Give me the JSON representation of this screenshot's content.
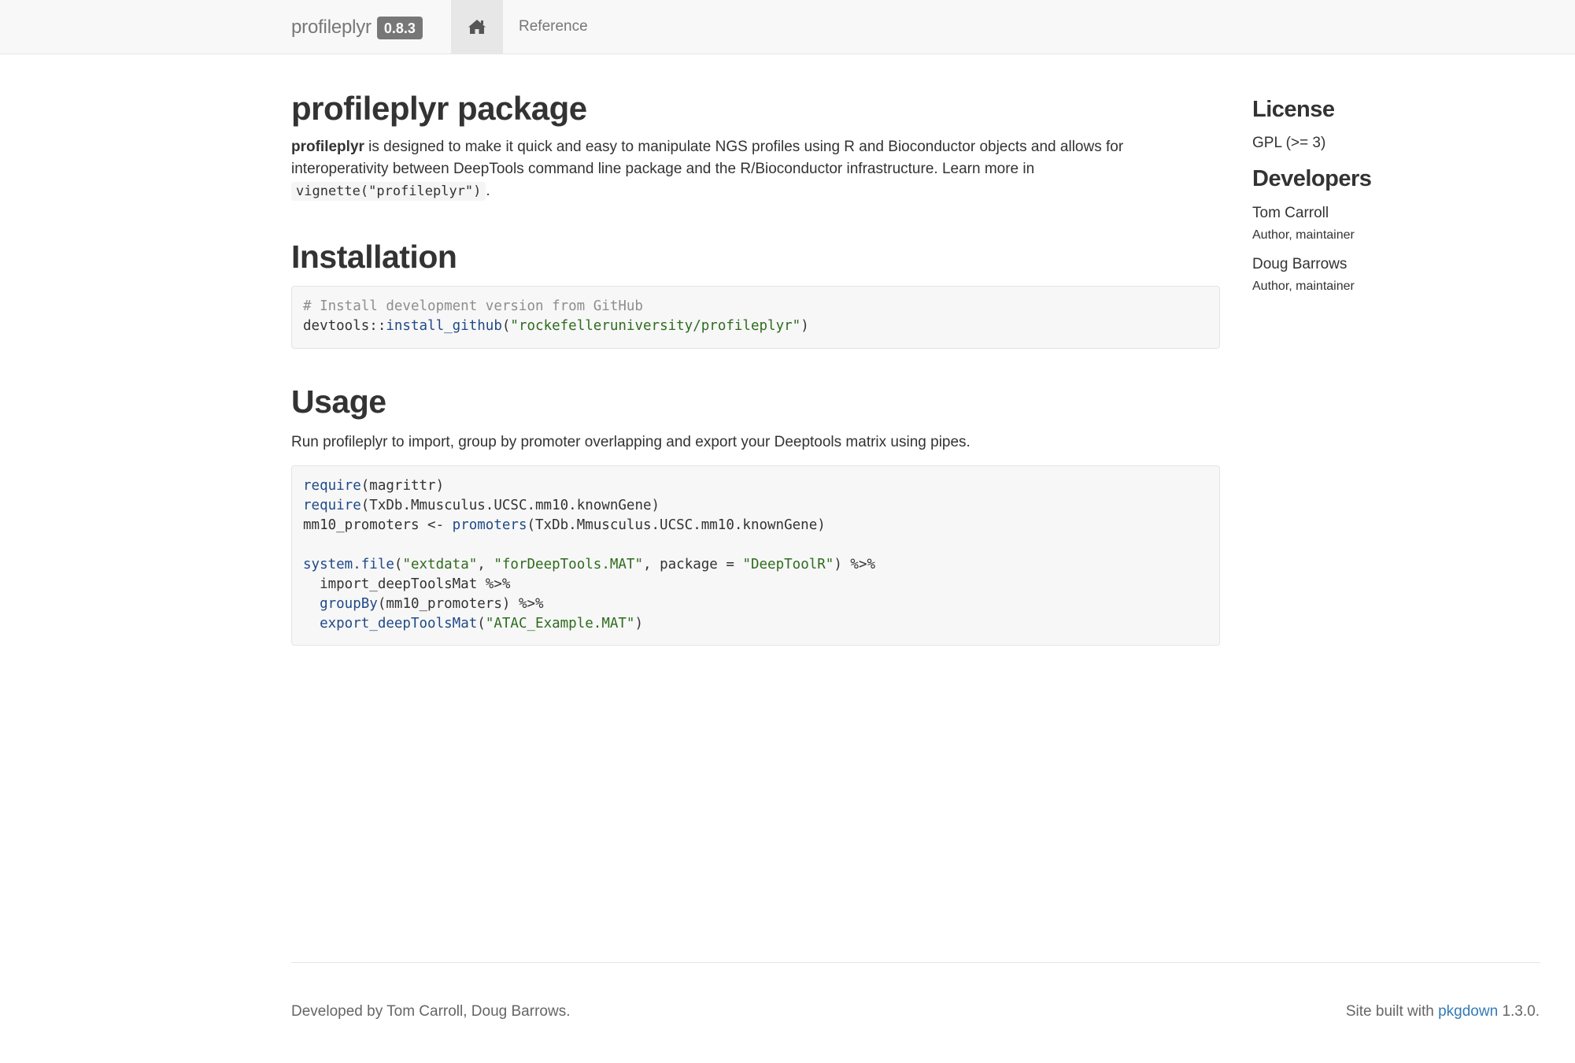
{
  "navbar": {
    "brand": "profileplyr",
    "version": "0.8.3",
    "home_icon": "home-icon",
    "reference_label": "Reference"
  },
  "main": {
    "title": "profileplyr package",
    "intro_strong": "profileplyr",
    "intro_text": " is designed to make it quick and easy to manipulate NGS profiles using R and Bioconductor objects and allows for interoperativity between DeepTools command line package and the R/Bioconductor infrastructure. Learn more in ",
    "intro_code": "vignette(\"profileplyr\")",
    "intro_end": ".",
    "installation_heading": "Installation",
    "install_code": {
      "comment": "# Install development version from GitHub",
      "line2_prefix": "devtools::",
      "line2_fn": "install_github",
      "line2_open": "(",
      "line2_str": "\"rockefelleruniversity/profileplyr\"",
      "line2_close": ")"
    },
    "usage_heading": "Usage",
    "usage_desc": "Run profileplyr to import, group by promoter overlapping and export your Deeptools matrix using pipes.",
    "usage_code": {
      "l1_fn": "require",
      "l1_rest": "(magrittr)",
      "l2_fn": "require",
      "l2_rest": "(TxDb.Mmusculus.UCSC.mm10.knownGene)",
      "l3_pre": "mm10_promoters <- ",
      "l3_fn": "promoters",
      "l3_rest": "(TxDb.Mmusculus.UCSC.mm10.knownGene)",
      "l5_fn": "system.file",
      "l5_open": "(",
      "l5_s1": "\"extdata\"",
      "l5_c1": ", ",
      "l5_s2": "\"forDeepTools.MAT\"",
      "l5_mid": ", package = ",
      "l5_s3": "\"DeepToolR\"",
      "l5_end": ") %>%",
      "l6": "  import_deepToolsMat %>%",
      "l7_indent": "  ",
      "l7_fn": "groupBy",
      "l7_rest": "(mm10_promoters) %>%",
      "l8_indent": "  ",
      "l8_fn": "export_deepToolsMat",
      "l8_open": "(",
      "l8_str": "\"ATAC_Example.MAT\"",
      "l8_close": ")"
    }
  },
  "sidebar": {
    "license_heading": "License",
    "license": "GPL (>= 3)",
    "developers_heading": "Developers",
    "developers": [
      {
        "name": "Tom Carroll",
        "role": "Author, maintainer"
      },
      {
        "name": "Doug Barrows",
        "role": "Author, maintainer"
      }
    ]
  },
  "footer": {
    "left": "Developed by Tom Carroll, Doug Barrows.",
    "right_prefix": "Site built with ",
    "right_link": "pkgdown",
    "right_suffix": " 1.3.0."
  },
  "colors": {
    "navbar_bg": "#f8f8f8",
    "badge_bg": "#777777",
    "link": "#337ab7",
    "code_bg": "#f7f7f7"
  }
}
